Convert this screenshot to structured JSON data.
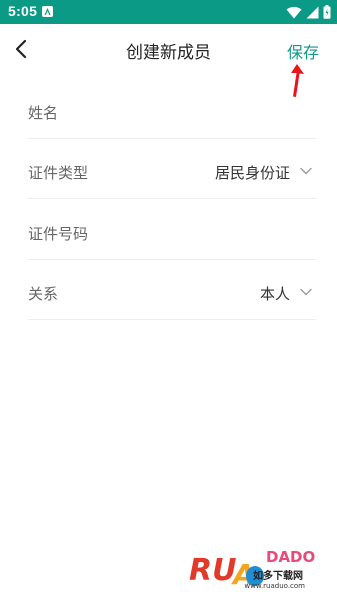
{
  "status_bar": {
    "time": "5:05",
    "background": "#0b9a86",
    "icons": [
      "app-notification-icon",
      "wifi-icon",
      "signal-icon",
      "battery-icon"
    ]
  },
  "header": {
    "title": "创建新成员",
    "save_label": "保存",
    "accent": "#11998a",
    "back_icon": "chevron-left-icon"
  },
  "form": {
    "rows": [
      {
        "label": "姓名",
        "value": "",
        "type": "input"
      },
      {
        "label": "证件类型",
        "value": "居民身份证",
        "type": "select"
      },
      {
        "label": "证件号码",
        "value": "",
        "type": "input"
      },
      {
        "label": "关系",
        "value": "本人",
        "type": "select"
      }
    ]
  },
  "watermark": {
    "brand": "RUANDADO",
    "cn": "如多下载网",
    "url": "www.ruaduo.com"
  }
}
